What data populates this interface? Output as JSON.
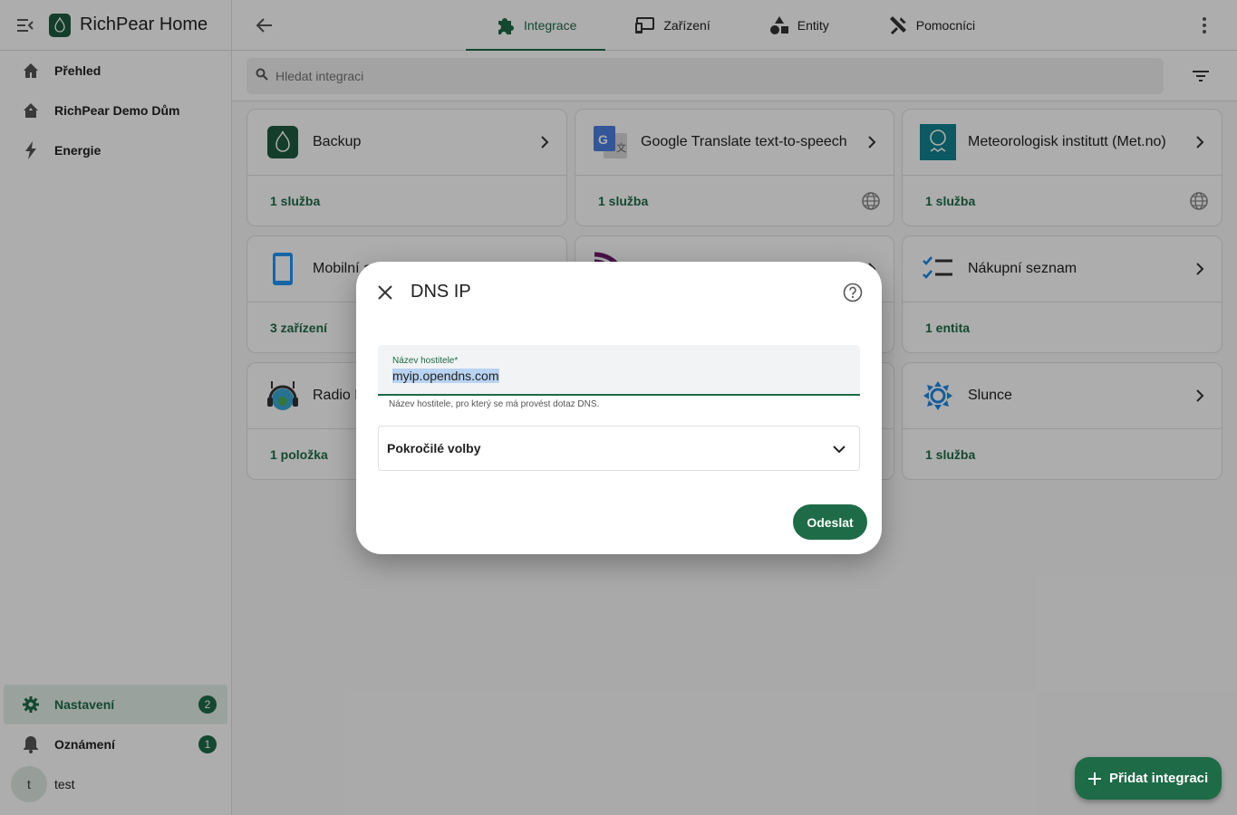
{
  "app": {
    "title": "RichPear Home"
  },
  "sidebar": {
    "top_items": [
      {
        "label": "Přehled",
        "icon": "home-icon"
      },
      {
        "label": "RichPear Demo Dům",
        "icon": "home-outline-icon"
      },
      {
        "label": "Energie",
        "icon": "lightning-icon"
      }
    ],
    "bottom_items": [
      {
        "label": "Nastavení",
        "icon": "gear-icon",
        "badge": "2"
      },
      {
        "label": "Oznámení",
        "icon": "bell-icon",
        "badge": "1"
      }
    ],
    "user": {
      "initial": "t",
      "name": "test"
    }
  },
  "tabs": [
    {
      "label": "Integrace",
      "icon": "puzzle-icon"
    },
    {
      "label": "Zařízení",
      "icon": "devices-icon"
    },
    {
      "label": "Entity",
      "icon": "shapes-icon"
    },
    {
      "label": "Pomocníci",
      "icon": "tools-icon"
    }
  ],
  "search": {
    "placeholder": "Hledat integraci"
  },
  "cards": [
    {
      "name": "Backup",
      "detail": "1 služba",
      "cloud": false
    },
    {
      "name": "Google Translate text-to-speech",
      "detail": "1 služba",
      "cloud": true
    },
    {
      "name": "Meteorologisk institutt (Met.no)",
      "detail": "1 služba",
      "cloud": true
    },
    {
      "name": "Mobilní aplikace",
      "detail": "3 zařízení",
      "cloud": false
    },
    {
      "name": "",
      "detail": "",
      "cloud": false
    },
    {
      "name": "Nákupní seznam",
      "detail": "1 entita",
      "cloud": false
    },
    {
      "name": "Radio Browser",
      "detail": "1 položka",
      "cloud": false
    },
    {
      "name": "",
      "detail": "",
      "cloud": false
    },
    {
      "name": "Slunce",
      "detail": "1 služba",
      "cloud": false
    }
  ],
  "fab": {
    "label": "Přidat integraci"
  },
  "dialog": {
    "title": "DNS IP",
    "field_label": "Název hostitele*",
    "field_value": "myip.opendns.com",
    "helper": "Název hostitele, pro který se má provést dotaz DNS.",
    "advanced_label": "Pokročilé volby",
    "submit_label": "Odeslat"
  },
  "colors": {
    "accent": "#1e6b47",
    "background": "#fafafa"
  }
}
